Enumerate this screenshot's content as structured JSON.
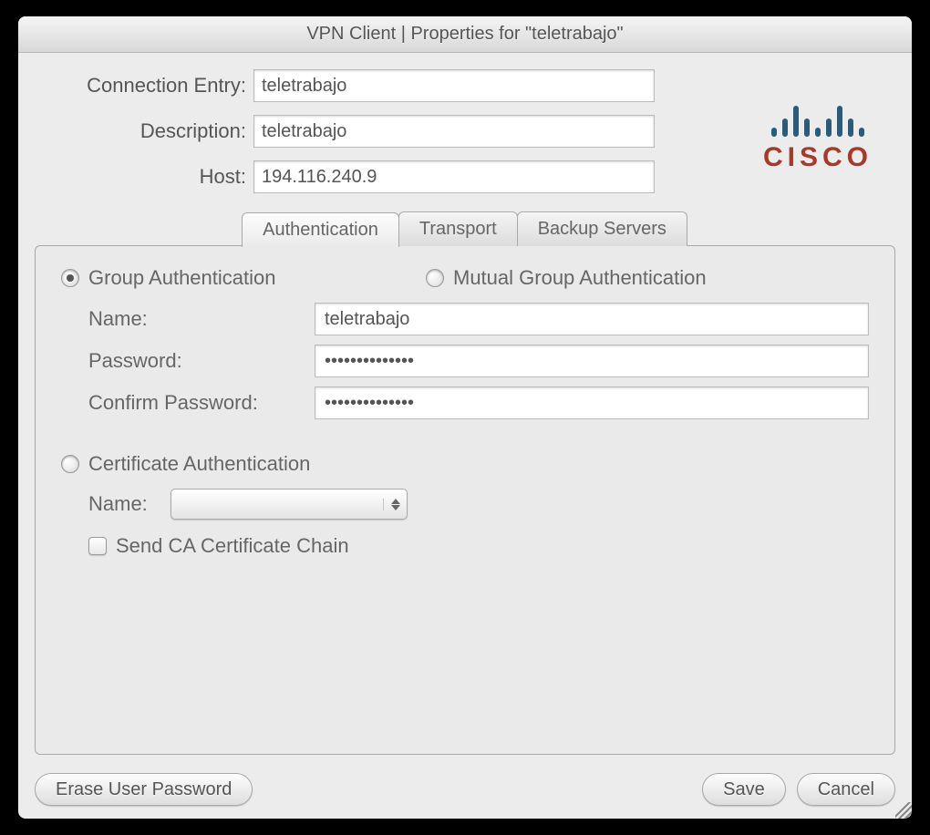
{
  "title": "VPN Client   |   Properties for \"teletrabajo\"",
  "fields": {
    "connection_entry": {
      "label": "Connection Entry:",
      "value": "teletrabajo"
    },
    "description": {
      "label": "Description:",
      "value": "teletrabajo"
    },
    "host": {
      "label": "Host:",
      "value": "194.116.240.9"
    }
  },
  "logo": {
    "text": "CISCO"
  },
  "tabs": {
    "authentication": "Authentication",
    "transport": "Transport",
    "backup_servers": "Backup Servers"
  },
  "auth": {
    "group_label": "Group Authentication",
    "mutual_label": "Mutual Group Authentication",
    "name": {
      "label": "Name:",
      "value": "teletrabajo"
    },
    "password": {
      "label": "Password:",
      "value": "••••••••••••••"
    },
    "confirm": {
      "label": "Confirm Password:",
      "value": "••••••••••••••"
    },
    "cert": {
      "label": "Certificate Authentication"
    },
    "cert_name": {
      "label": "Name:",
      "value": ""
    },
    "send_ca": {
      "label": "Send CA Certificate Chain"
    }
  },
  "buttons": {
    "erase": "Erase User Password",
    "save": "Save",
    "cancel": "Cancel"
  }
}
